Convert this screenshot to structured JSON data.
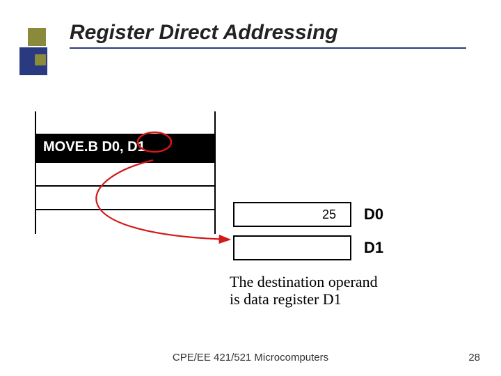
{
  "title": "Register Direct Addressing",
  "instruction": "MOVE.B D0, D1",
  "registers": {
    "d0": {
      "value": "25",
      "label": "D0"
    },
    "d1": {
      "value": "",
      "label": "D1"
    }
  },
  "caption_line1": "The destination operand",
  "caption_line2": "is data register D1",
  "footer": "CPE/EE 421/521 Microcomputers",
  "page_number": "28",
  "colors": {
    "accent_olive": "#8a8a3a",
    "accent_navy": "#2a3a80",
    "arrow": "#d21919"
  }
}
